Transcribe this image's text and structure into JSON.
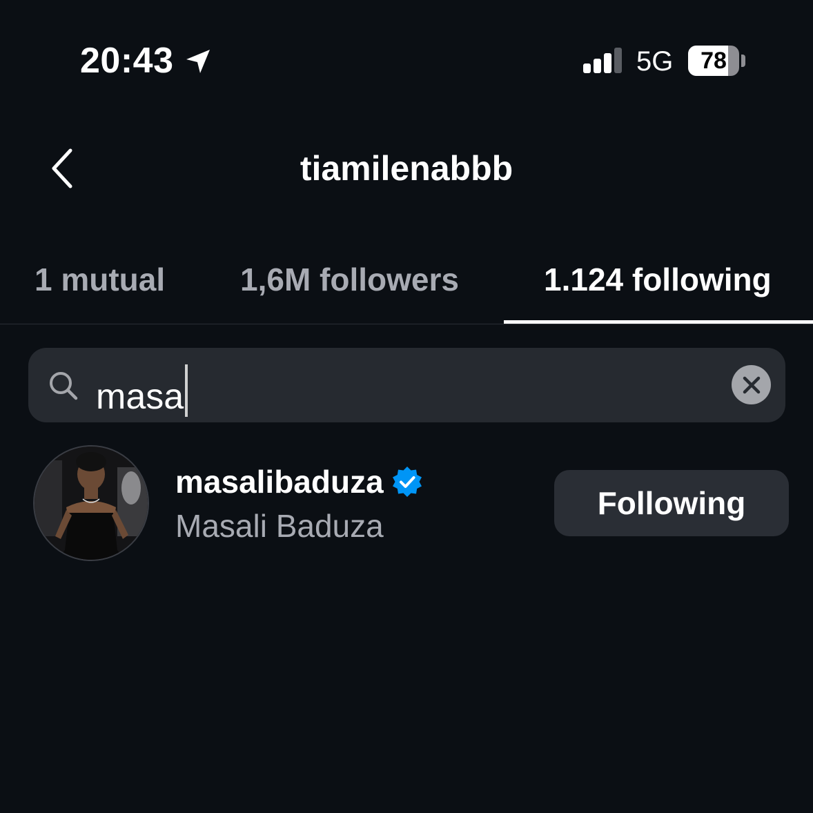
{
  "status_bar": {
    "time": "20:43",
    "network": "5G",
    "battery_level": "78",
    "battery_fraction": 0.78,
    "signal_bars_active": 3,
    "signal_bars_total": 4
  },
  "header": {
    "title": "tiamilenabbb"
  },
  "tabs": [
    {
      "label": "1 mutual",
      "active": false
    },
    {
      "label": "1,6M followers",
      "active": false
    },
    {
      "label": "1.124 following",
      "active": true
    }
  ],
  "search": {
    "value": "masa",
    "placeholder": "Search"
  },
  "results": [
    {
      "username": "masalibaduza",
      "verified": true,
      "full_name": "Masali Baduza",
      "button_label": "Following"
    }
  ],
  "colors": {
    "background": "#0b0f14",
    "verified_blue": "#0095f6",
    "secondary_text": "#a8abb3",
    "button_bg": "#2a2e35"
  },
  "icons": {
    "back": "chevron-left-icon",
    "location": "location-arrow-icon",
    "signal": "cellular-signal-icon",
    "search": "search-icon",
    "clear": "close-icon",
    "verified": "verified-badge-icon"
  }
}
